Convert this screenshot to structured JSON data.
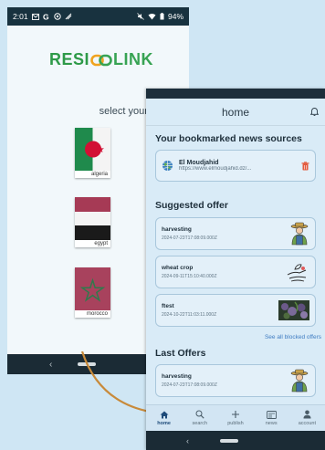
{
  "country_screen": {
    "status": {
      "time": "2:01",
      "icons_left": [
        "mail-icon",
        "g-icon",
        "circle-icon",
        "signal-icon"
      ],
      "battery": "94%"
    },
    "logo": {
      "left": "RESI",
      "right": "LINK"
    },
    "title": "select your country",
    "countries": [
      {
        "label": "algeria"
      },
      {
        "label": "egypt"
      },
      {
        "label": "morocco"
      }
    ],
    "nav": {
      "back": "‹"
    }
  },
  "home_screen": {
    "header_title": "home",
    "bookmarked_title": "Your bookmarked news sources",
    "source": {
      "name": "El Moudjahid",
      "url": "https://www.elmoudjahid.dz/..."
    },
    "suggested_title": "Suggested offer",
    "suggested": [
      {
        "title": "harvesting",
        "date": "2024-07-23T17:08:09.000Z"
      },
      {
        "title": "wheat crop",
        "date": "2024-09-11T15:10:40.000Z"
      },
      {
        "title": "ftest",
        "date": "2024-10-22T11:03:11.000Z"
      }
    ],
    "see_all": "See all blocked offers",
    "last_title": "Last Offers",
    "last": [
      {
        "title": "harvesting",
        "date": "2024-07-23T17:08:09.000Z"
      }
    ],
    "nav": [
      {
        "label": "home"
      },
      {
        "label": "search"
      },
      {
        "label": "publish"
      },
      {
        "label": "news"
      },
      {
        "label": "account"
      }
    ],
    "sys_back": "‹"
  },
  "colors": {
    "accent": "#2e9a48",
    "link": "#3f7cc2",
    "dark_bar": "#1b2b35"
  }
}
